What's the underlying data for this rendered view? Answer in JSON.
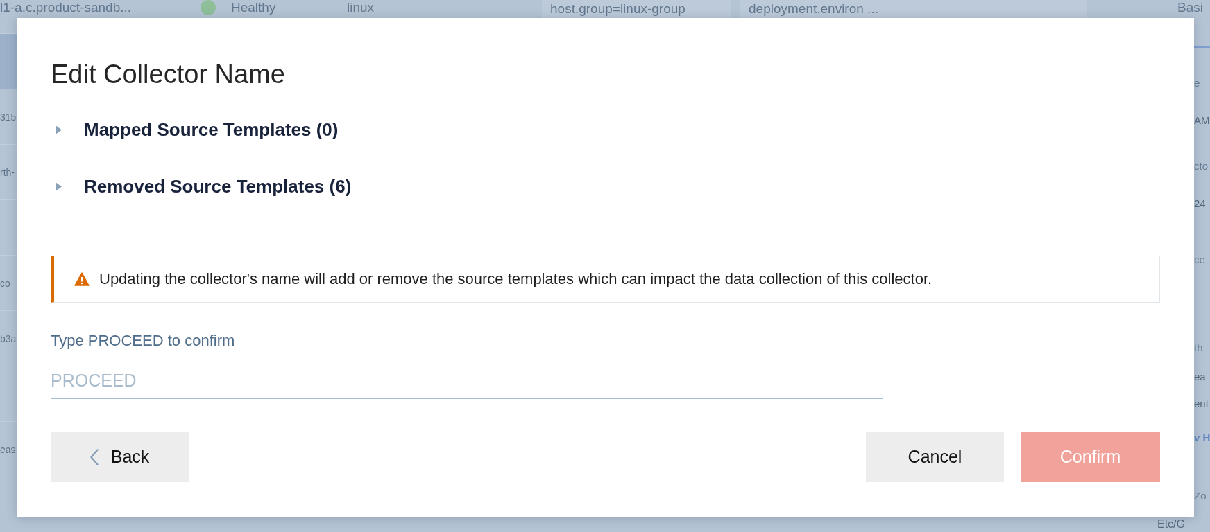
{
  "background": {
    "header_row": {
      "name": "l1-a.c.product-sandb...",
      "status": {
        "label": "Healthy",
        "color": "#8fbf99"
      },
      "os": "linux",
      "tags": [
        "host.group=linux-group",
        "deployment.environ ..."
      ],
      "tab": "Basi"
    },
    "rows": [
      {
        "selected": true
      },
      {
        "selected": false,
        "cell": "315"
      },
      {
        "selected": false,
        "cell": "rth-"
      },
      {
        "selected": false
      },
      {
        "selected": false,
        "cell": "co"
      },
      {
        "selected": false,
        "cell": "b3a"
      },
      {
        "selected": false
      },
      {
        "selected": false,
        "cell": "eas"
      }
    ],
    "details": [
      {
        "kind": "label",
        "text": "e"
      },
      {
        "kind": "value",
        "text": "AM"
      },
      {
        "kind": "label",
        "text": "cto"
      },
      {
        "kind": "value",
        "text": "24"
      },
      {
        "kind": "label",
        "text": "ce"
      },
      {
        "kind": "label",
        "text": "th"
      },
      {
        "kind": "value",
        "text": "ea"
      },
      {
        "kind": "value",
        "text": "ent"
      },
      {
        "kind": "link",
        "text": "v H"
      },
      {
        "kind": "label",
        "text": "Zo"
      }
    ],
    "footer_value": "Etc/G"
  },
  "dialog": {
    "title": "Edit Collector Name",
    "sections": [
      {
        "label": "Mapped Source Templates (0)",
        "expanded": false
      },
      {
        "label": "Removed Source Templates (6)",
        "expanded": false
      }
    ],
    "warning": {
      "text": "Updating the collector's name will add or remove the source templates which can impact the data collection of this collector."
    },
    "confirm_field": {
      "label": "Type PROCEED to confirm",
      "placeholder": "PROCEED"
    },
    "buttons": [
      {
        "kind": "back",
        "label": "Back",
        "disabled": false
      },
      {
        "kind": "secondary",
        "label": "Cancel",
        "disabled": false
      },
      {
        "kind": "primary",
        "label": "Confirm",
        "disabled": true
      }
    ]
  }
}
